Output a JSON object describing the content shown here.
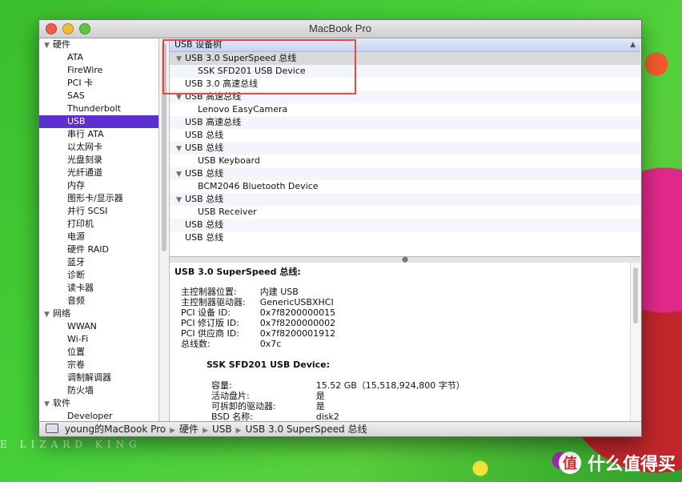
{
  "window": {
    "title": "MacBook Pro"
  },
  "sidebar": {
    "groups": [
      {
        "label": "硬件",
        "items": [
          "ATA",
          "FireWire",
          "PCI 卡",
          "SAS",
          "Thunderbolt",
          "USB",
          "串行 ATA",
          "以太网卡",
          "光盘刻录",
          "光纤通道",
          "内存",
          "图形卡/显示器",
          "并行 SCSI",
          "打印机",
          "电源",
          "硬件 RAID",
          "蓝牙",
          "诊断",
          "读卡器",
          "音频"
        ]
      },
      {
        "label": "网络",
        "items": [
          "WWAN",
          "Wi-Fi",
          "位置",
          "宗卷",
          "调制解调器",
          "防火墙"
        ]
      },
      {
        "label": "软件",
        "items": [
          "Developer"
        ]
      }
    ],
    "selected_item": "USB"
  },
  "tree": {
    "header": "USB 设备树",
    "rows": [
      {
        "label": "USB 3.0 SuperSpeed 总线",
        "level": 0,
        "expanded": true,
        "selected": true
      },
      {
        "label": "SSK SFD201 USB Device",
        "level": 1
      },
      {
        "label": "USB 3.0 高速总线",
        "level": 0
      },
      {
        "label": "USB 高速总线",
        "level": 0,
        "expanded": true
      },
      {
        "label": "Lenovo EasyCamera",
        "level": 1
      },
      {
        "label": "USB 高速总线",
        "level": 0
      },
      {
        "label": "USB 总线",
        "level": 0
      },
      {
        "label": "USB 总线",
        "level": 0,
        "expanded": true
      },
      {
        "label": "USB Keyboard",
        "level": 1
      },
      {
        "label": "USB 总线",
        "level": 0,
        "expanded": true
      },
      {
        "label": "BCM2046 Bluetooth Device",
        "level": 1
      },
      {
        "label": "USB 总线",
        "level": 0,
        "expanded": true
      },
      {
        "label": "USB Receiver",
        "level": 1
      },
      {
        "label": "USB 总线",
        "level": 0
      },
      {
        "label": "USB 总线",
        "level": 0
      }
    ]
  },
  "detail": {
    "title": "USB 3.0 SuperSpeed 总线:",
    "properties": [
      {
        "key": "主控制器位置:",
        "value": "内建 USB"
      },
      {
        "key": "主控制器驱动器:",
        "value": "GenericUSBXHCI"
      },
      {
        "key": "PCI 设备 ID:",
        "value": "0x7f8200000015"
      },
      {
        "key": "PCI 修订版 ID:",
        "value": "0x7f8200000002"
      },
      {
        "key": "PCI 供应商 ID:",
        "value": "0x7f8200001912"
      },
      {
        "key": "总线数:",
        "value": "0x7c"
      }
    ],
    "device_title": "SSK SFD201 USB Device:",
    "device_properties": [
      {
        "key": "容量:",
        "value": "15.52 GB（15,518,924,800 字节）"
      },
      {
        "key": "活动盘片:",
        "value": "是"
      },
      {
        "key": "可拆卸的驱动器:",
        "value": "是"
      },
      {
        "key": "BSD 名称:",
        "value": "disk2"
      }
    ]
  },
  "statusbar": {
    "path": [
      "young的MacBook Pro",
      "硬件",
      "USB",
      "USB 3.0 SuperSpeed 总线"
    ]
  },
  "watermark": {
    "left_text": "E LIZARD KING",
    "right_text": "什么值得买",
    "logo_glyph": "值"
  }
}
